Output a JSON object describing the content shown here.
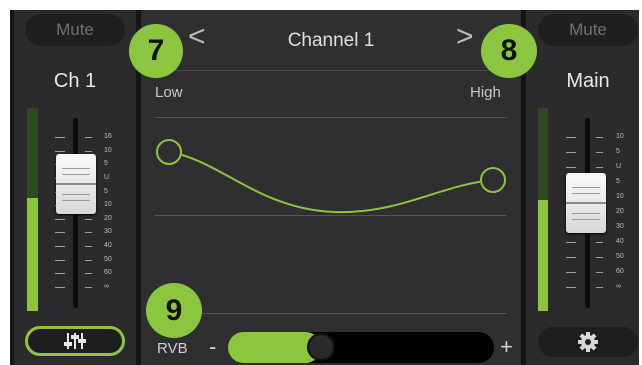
{
  "left_strip": {
    "mute_label": "Mute",
    "channel_name": "Ch 1",
    "meter_level": 0.47,
    "fader_scale": [
      "16",
      "10",
      "5",
      "U",
      "5",
      "10",
      "20",
      "30",
      "40",
      "50",
      "60",
      "∞"
    ],
    "eq_button_icon": "eq-sliders-icon"
  },
  "center": {
    "prev_symbol": "<",
    "next_symbol": ">",
    "title": "Channel 1",
    "low_label": "Low",
    "high_label": "High",
    "rvb_label": "RVB",
    "rvb_minus": "-",
    "rvb_plus": "+",
    "rvb_level": 0.35
  },
  "right_strip": {
    "mute_label": "Mute",
    "channel_name": "Main",
    "meter_level": 0.6,
    "fader_scale": [
      "10",
      "5",
      "U",
      "5",
      "10",
      "20",
      "30",
      "40",
      "50",
      "60",
      "∞"
    ],
    "settings_icon": "gear-icon"
  },
  "callouts": {
    "b7": "7",
    "b8": "8",
    "b9": "9"
  },
  "colors": {
    "accent": "#8cc63f",
    "panel": "#2b2b2d",
    "background": "#151515"
  }
}
